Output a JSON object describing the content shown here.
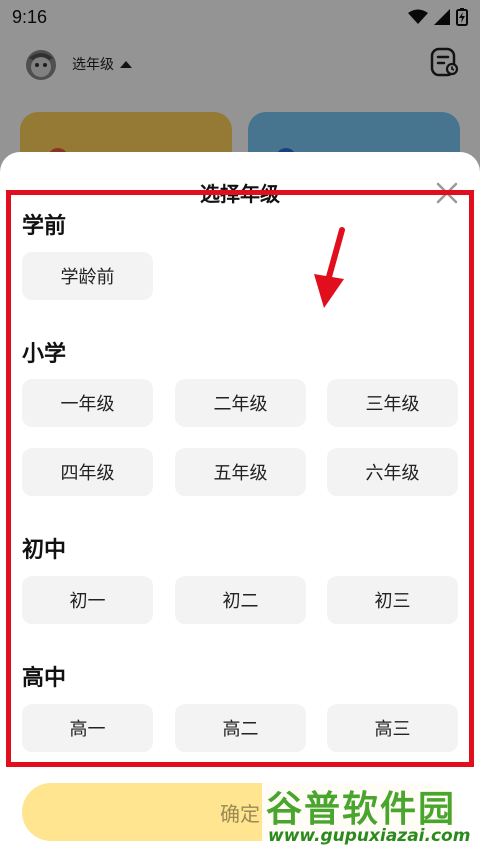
{
  "status": {
    "time": "9:16"
  },
  "topbar": {
    "grade_label": "选年级"
  },
  "sheet": {
    "title": "选择年级",
    "sections": [
      {
        "title": "学前",
        "items": [
          "学龄前"
        ]
      },
      {
        "title": "小学",
        "items": [
          "一年级",
          "二年级",
          "三年级",
          "四年级",
          "五年级",
          "六年级"
        ]
      },
      {
        "title": "初中",
        "items": [
          "初一",
          "初二",
          "初三"
        ]
      },
      {
        "title": "高中",
        "items": [
          "高一",
          "高二",
          "高三"
        ]
      }
    ],
    "confirm_label": "确定"
  },
  "watermark": {
    "text": "谷普软件园",
    "url": "www.gupuxiazai.com"
  },
  "colors": {
    "accent_yellow": "#ffe58f",
    "annotation_red": "#e10f1d",
    "watermark_green": "#4aa52e"
  }
}
